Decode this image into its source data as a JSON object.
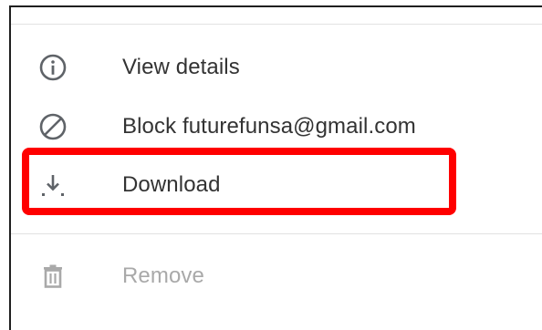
{
  "menu": {
    "items": [
      {
        "label": "View details",
        "icon": "info-icon",
        "disabled": false
      },
      {
        "label": "Block futurefunsa@gmail.com",
        "icon": "block-icon",
        "disabled": false
      },
      {
        "label": "Download",
        "icon": "download-icon",
        "disabled": false
      },
      {
        "label": "Remove",
        "icon": "trash-icon",
        "disabled": true
      }
    ]
  },
  "colors": {
    "icon": "#5f6368",
    "text": "#333333",
    "disabled": "#a9a9a9",
    "highlight": "#ff0000"
  }
}
